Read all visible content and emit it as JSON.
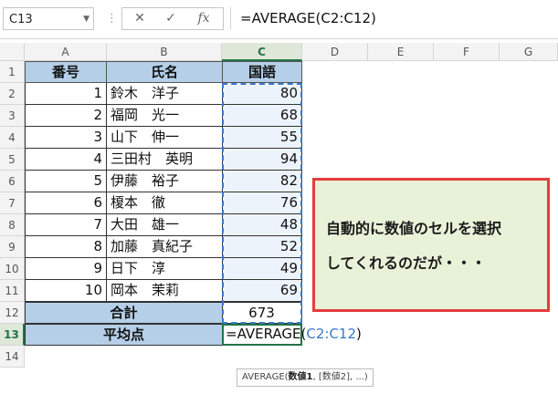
{
  "name_box": "C13",
  "formula_buttons": {
    "cancel": "✕",
    "enter": "✓",
    "fx": "fx"
  },
  "formula_bar_text": "=AVERAGE(C2:C12)",
  "columns": [
    "A",
    "B",
    "C",
    "D",
    "E",
    "F",
    "G"
  ],
  "rows": [
    "1",
    "2",
    "3",
    "4",
    "5",
    "6",
    "7",
    "8",
    "9",
    "10",
    "11",
    "12",
    "13",
    "14"
  ],
  "table": {
    "headers": [
      "番号",
      "氏名",
      "国語"
    ],
    "records": [
      [
        "1",
        "鈴木　洋子",
        "80"
      ],
      [
        "2",
        "福岡　光一",
        "68"
      ],
      [
        "3",
        "山下　伸一",
        "55"
      ],
      [
        "4",
        "三田村　英明",
        "94"
      ],
      [
        "5",
        "伊藤　裕子",
        "82"
      ],
      [
        "6",
        "榎本　徹",
        "76"
      ],
      [
        "7",
        "大田　雄一",
        "48"
      ],
      [
        "8",
        "加藤　真紀子",
        "52"
      ],
      [
        "9",
        "日下　淳",
        "49"
      ],
      [
        "10",
        "岡本　茉莉",
        "69"
      ]
    ],
    "total_label": "合計",
    "total_value": "673",
    "avg_label": "平均点",
    "avg_formula_prefix": "=AVERAGE(",
    "avg_formula_range": "C2:C12",
    "avg_formula_suffix": ")"
  },
  "note": {
    "line1": "自動的に数値のセルを選択",
    "line2": "してくれるのだが・・・"
  },
  "tooltip": {
    "func": "AVERAGE(",
    "arg1": "数値1",
    "rest": ", [数値2], ...)"
  },
  "colors": {
    "header_fill": "#b5cfe8",
    "note_fill": "#e8f2d8",
    "note_border": "#e53c3c",
    "range": "#3a78c7"
  }
}
